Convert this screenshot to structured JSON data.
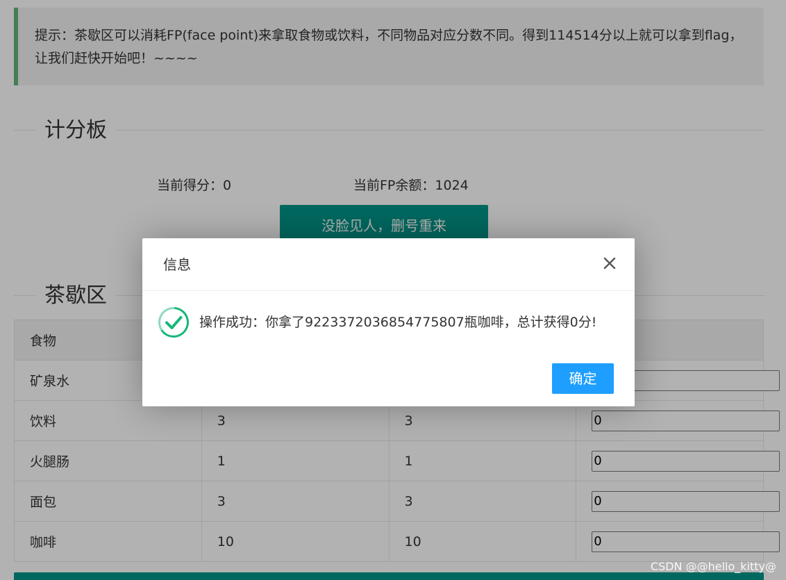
{
  "tip": {
    "text": "提示：茶歇区可以消耗FP(face point)来拿取食物或饮料，不同物品对应分数不同。得到114514分以上就可以拿到flag，让我们赶快开始吧！~~~~"
  },
  "scoreboard": {
    "title": "计分板",
    "score_text": "当前得分：0",
    "fp_text": "当前FP余额：1024",
    "reset_label": "没脸见人，删号重来"
  },
  "shop": {
    "title": "茶歇区",
    "headers": [
      "食物",
      "",
      "",
      ""
    ],
    "rows": [
      {
        "name": "矿泉水",
        "col2": "",
        "col3": "",
        "qty": ""
      },
      {
        "name": "饮料",
        "col2": "3",
        "col3": "3",
        "qty": "0"
      },
      {
        "name": "火腿肠",
        "col2": "1",
        "col3": "1",
        "qty": "0"
      },
      {
        "name": "面包",
        "col2": "3",
        "col3": "3",
        "qty": "0"
      },
      {
        "name": "咖啡",
        "col2": "10",
        "col3": "10",
        "qty": "0"
      }
    ]
  },
  "dialog": {
    "title": "信息",
    "message": "操作成功：你拿了9223372036854775807瓶咖啡，总计获得0分!",
    "confirm_label": "确定",
    "icons": {
      "close": "close-icon",
      "success": "success-check-icon"
    }
  },
  "colors": {
    "accent_teal": "#009688",
    "tip_border": "#5fb878",
    "confirm_blue": "#1e9fff",
    "success_green": "#16b777"
  },
  "watermark": "CSDN @@hello_kitty@"
}
